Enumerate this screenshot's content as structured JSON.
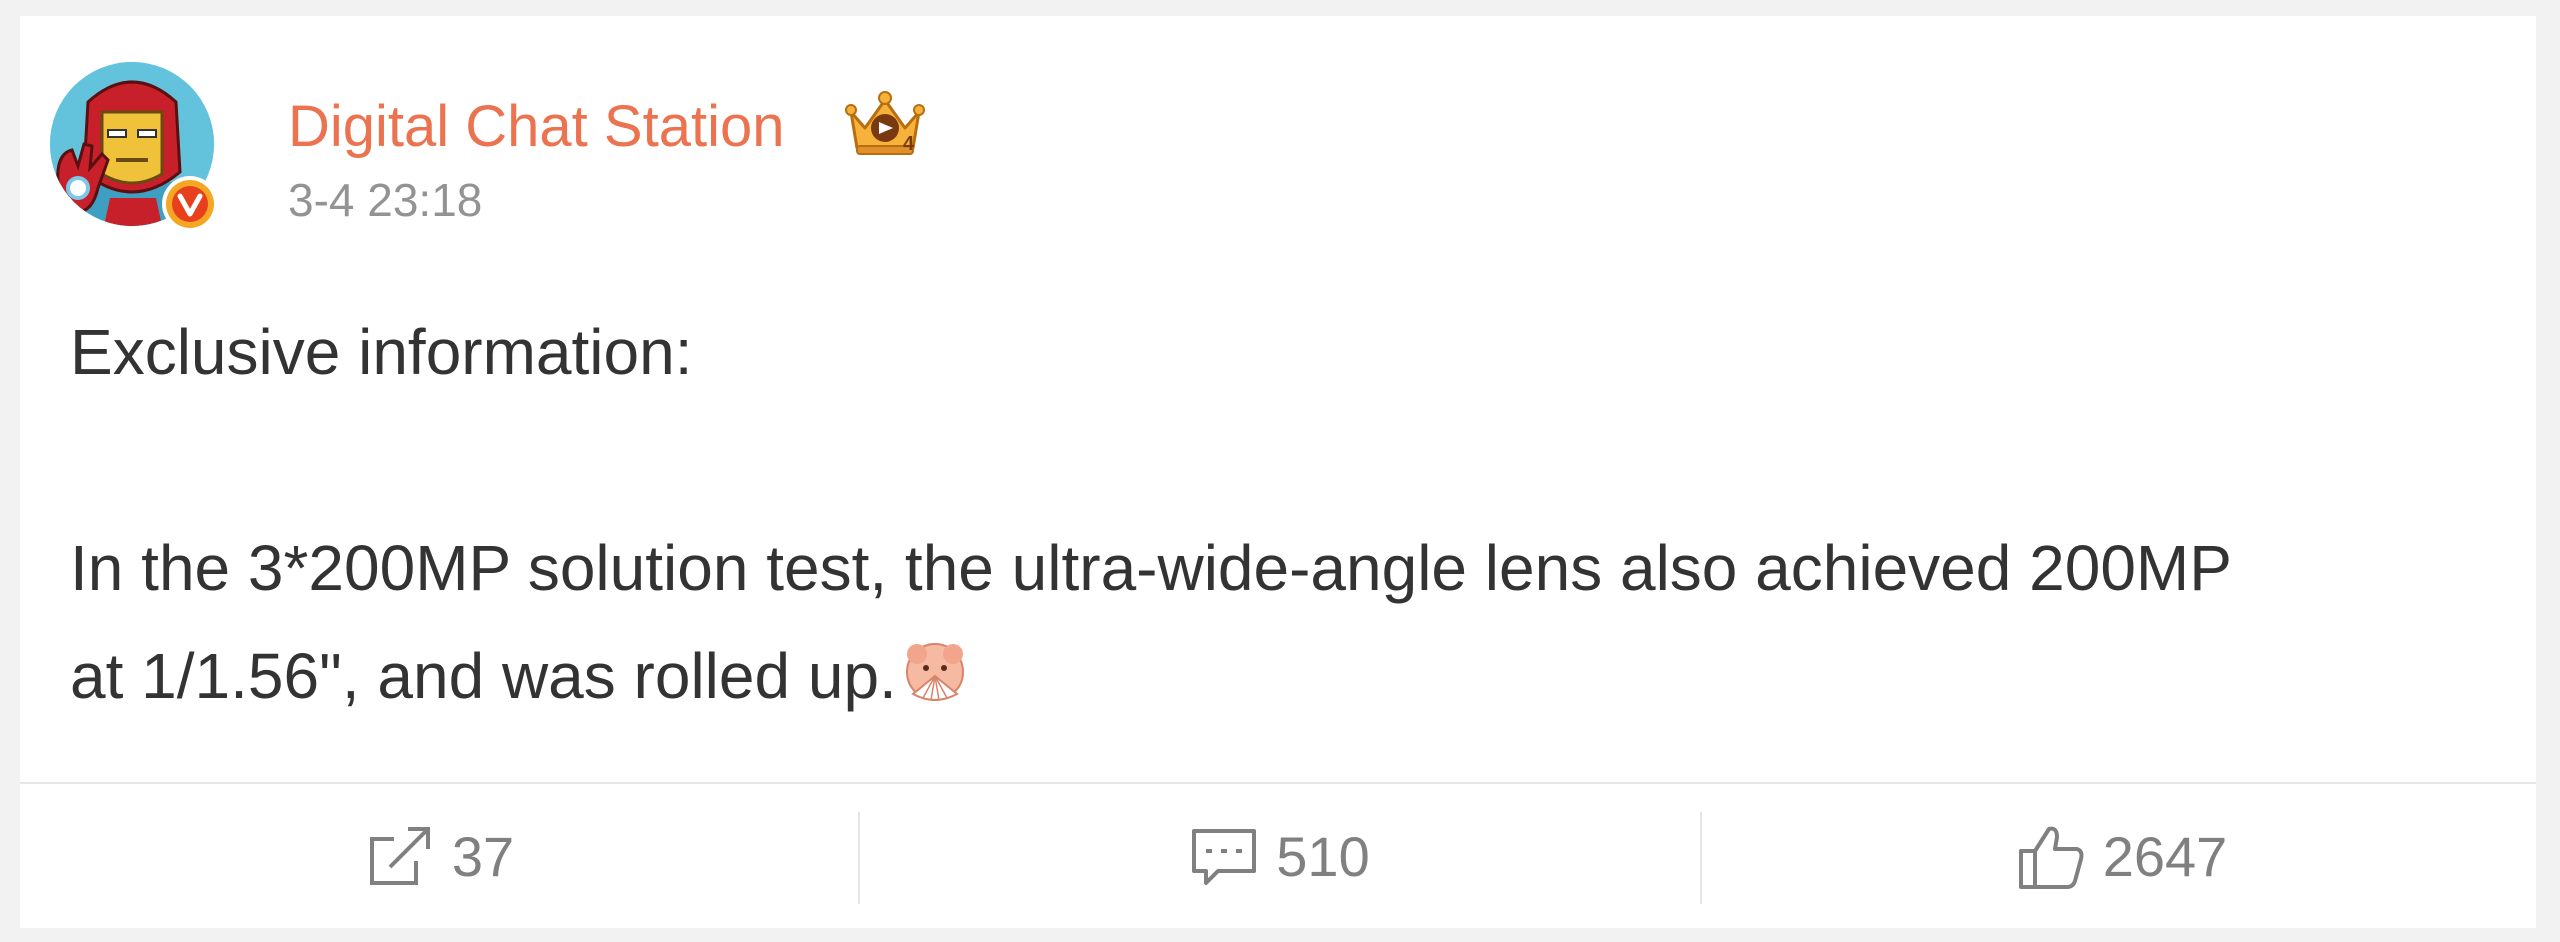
{
  "post": {
    "author": {
      "name": "Digital Chat Station",
      "avatar_icon": "iron-man-avatar",
      "verified_icon": "verified-v-badge",
      "level_icon": "crown-badge-icon"
    },
    "time": "3-4 23:18",
    "content": {
      "line1": "Exclusive information:",
      "line2": "In the 3*200MP solution test, the ultra-wide-angle lens also achieved 200MP",
      "line3": "at 1/1.56\", and was rolled up.",
      "emoji_icon": "fan-face-emoji"
    }
  },
  "actions": {
    "repost": {
      "icon": "repost-icon",
      "count": "37"
    },
    "comment": {
      "icon": "comment-icon",
      "count": "510"
    },
    "like": {
      "icon": "thumbs-up-icon",
      "count": "2647"
    }
  },
  "colors": {
    "name": "#eb7350",
    "time": "#939393",
    "text": "#333333",
    "count": "#808080",
    "divider": "#e6e6e6",
    "page_bg": "#f2f2f2",
    "card_bg": "#ffffff"
  }
}
